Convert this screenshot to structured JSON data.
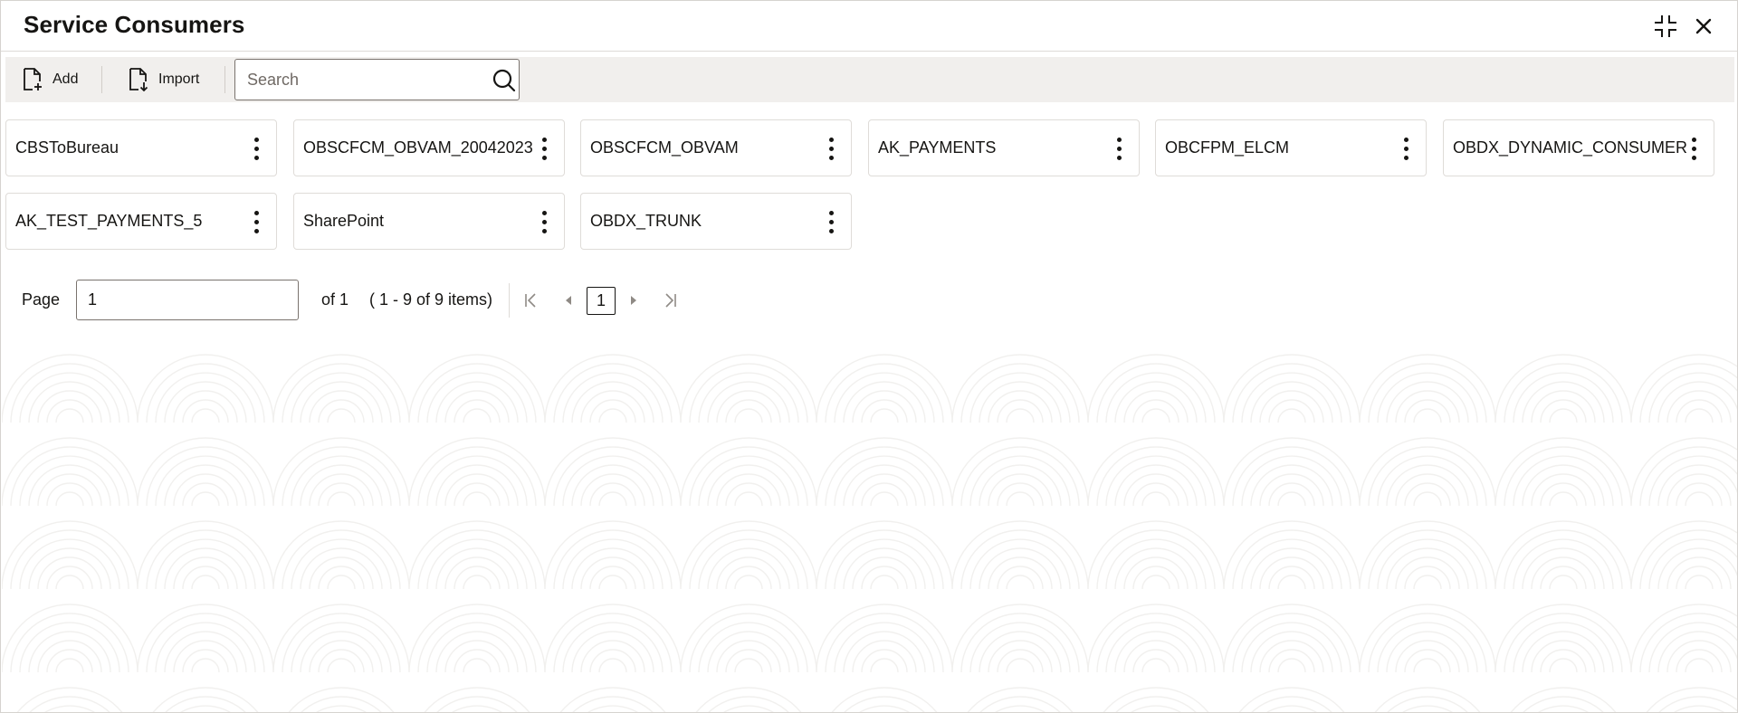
{
  "header": {
    "title": "Service Consumers",
    "collapse_icon": "collapse-icon",
    "close_icon": "close-icon"
  },
  "toolbar": {
    "add_label": "Add",
    "import_label": "Import",
    "search_placeholder": "Search",
    "search_value": ""
  },
  "cards": [
    {
      "label": "CBSToBureau"
    },
    {
      "label": "OBSCFCM_OBVAM_20042023"
    },
    {
      "label": "OBSCFCM_OBVAM"
    },
    {
      "label": "AK_PAYMENTS"
    },
    {
      "label": "OBCFPM_ELCM"
    },
    {
      "label": "OBDX_DYNAMIC_CONSUMER"
    },
    {
      "label": "AK_TEST_PAYMENTS_5"
    },
    {
      "label": "SharePoint"
    },
    {
      "label": "OBDX_TRUNK"
    }
  ],
  "pagination": {
    "page_label": "Page",
    "page_value": "1",
    "of_label": "of 1",
    "items_summary": "( 1 - 9 of 9 items)",
    "current_page": "1"
  },
  "colors": {
    "toolbar_bg": "#f1efed",
    "text": "#161513",
    "border": "#dfdcd8"
  }
}
